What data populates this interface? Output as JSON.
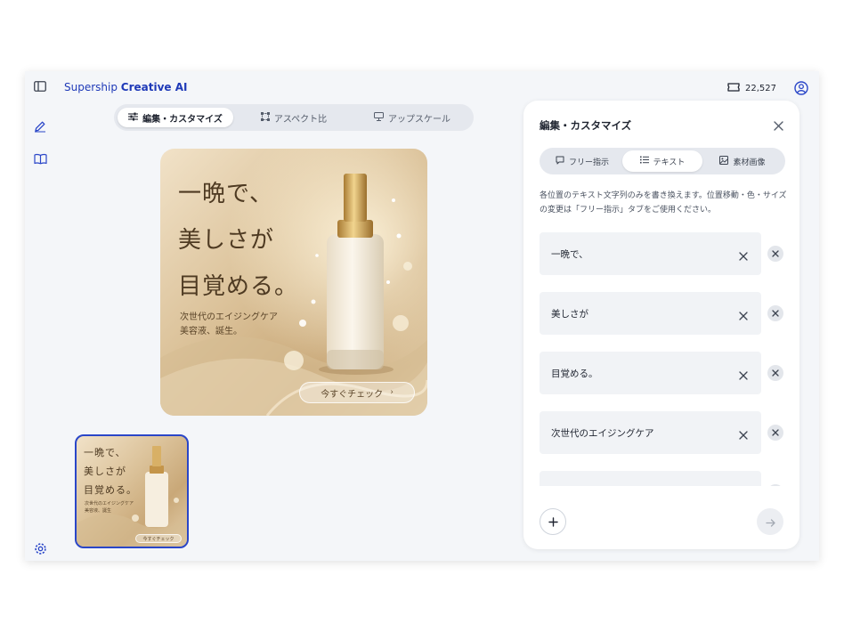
{
  "app": {
    "brand_prefix": "Supership",
    "brand_name": "Creative AI",
    "credits": "22,527"
  },
  "toolbar": {
    "tabs": [
      {
        "label": "編集・カスタマイズ",
        "icon": "sliders-icon",
        "active": true
      },
      {
        "label": "アスペクト比",
        "icon": "crop-icon",
        "active": false
      },
      {
        "label": "アップスケール",
        "icon": "upscale-icon",
        "active": false
      }
    ]
  },
  "ad": {
    "line1": "一晩で、",
    "line2": "美しさが",
    "line3": "目覚める。",
    "sub1": "次世代のエイジングケア",
    "sub2": "美容液、誕生。",
    "cta": "今すぐチェック",
    "thumb_sub2": "美容液、誕生"
  },
  "panel": {
    "title": "編集・カスタマイズ",
    "tabs": [
      {
        "label": "フリー指示",
        "icon": "chat-icon"
      },
      {
        "label": "テキスト",
        "icon": "list-icon"
      },
      {
        "label": "素材画像",
        "icon": "image-icon"
      }
    ],
    "description": "各位置のテキスト文字列のみを書き換えます。位置移動・色・サイズの変更は「フリー指示」タブをご使用ください。",
    "fields": [
      {
        "value": "一晩で、"
      },
      {
        "value": "美しさが"
      },
      {
        "value": "目覚める。"
      },
      {
        "value": "次世代のエイジングケア"
      },
      {
        "value": ""
      }
    ]
  },
  "colors": {
    "accent": "#1f3ab8",
    "selected_border": "#2a46c8",
    "canvas_bg": "#f4f6f9"
  }
}
